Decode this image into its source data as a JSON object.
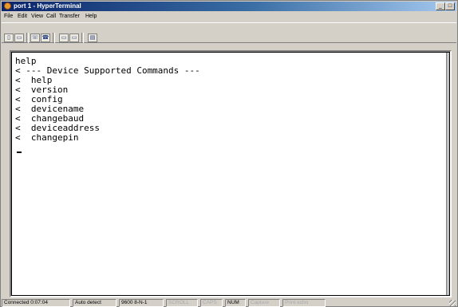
{
  "window": {
    "title": "port 1 - HyperTerminal",
    "min_symbol": "_",
    "max_symbol": "□"
  },
  "menu": [
    "File",
    "Edit",
    "View",
    "Call",
    "Transfer",
    "Help"
  ],
  "toolbar": {
    "buttons": [
      {
        "name": "new-connection",
        "icon": "new-doc-icon",
        "glyph": "▯"
      },
      {
        "name": "open",
        "icon": "folder-open-icon",
        "glyph": "▭"
      },
      {
        "name": "call",
        "icon": "phone-call-icon",
        "glyph": "☏"
      },
      {
        "name": "disconnect",
        "icon": "phone-hangup-icon",
        "glyph": "☎"
      },
      {
        "name": "send",
        "icon": "send-file-icon",
        "glyph": "▭"
      },
      {
        "name": "receive",
        "icon": "receive-file-icon",
        "glyph": "▭"
      },
      {
        "name": "properties",
        "icon": "properties-icon",
        "glyph": "▤"
      }
    ]
  },
  "terminal": {
    "lines": [
      "help",
      "< --- Device Supported Commands ---",
      "<  help",
      "<  version",
      "<  config",
      "<  devicename",
      "<  changebaud",
      "<  deviceaddress",
      "<  changepin"
    ],
    "cursor": "_"
  },
  "status": {
    "connected": "Connected 0:07:04",
    "detect": "Auto detect",
    "settings": "9600 8-N-1",
    "scroll": "SCROLL",
    "caps": "CAPS",
    "num": "NUM",
    "capture": "Capture",
    "print_echo": "Print echo"
  },
  "colors": {
    "title_active": "#0a246a",
    "chrome": "#d4d0c8",
    "terminal_bg": "#ffffff",
    "disabled_text": "#a8a8a8"
  }
}
